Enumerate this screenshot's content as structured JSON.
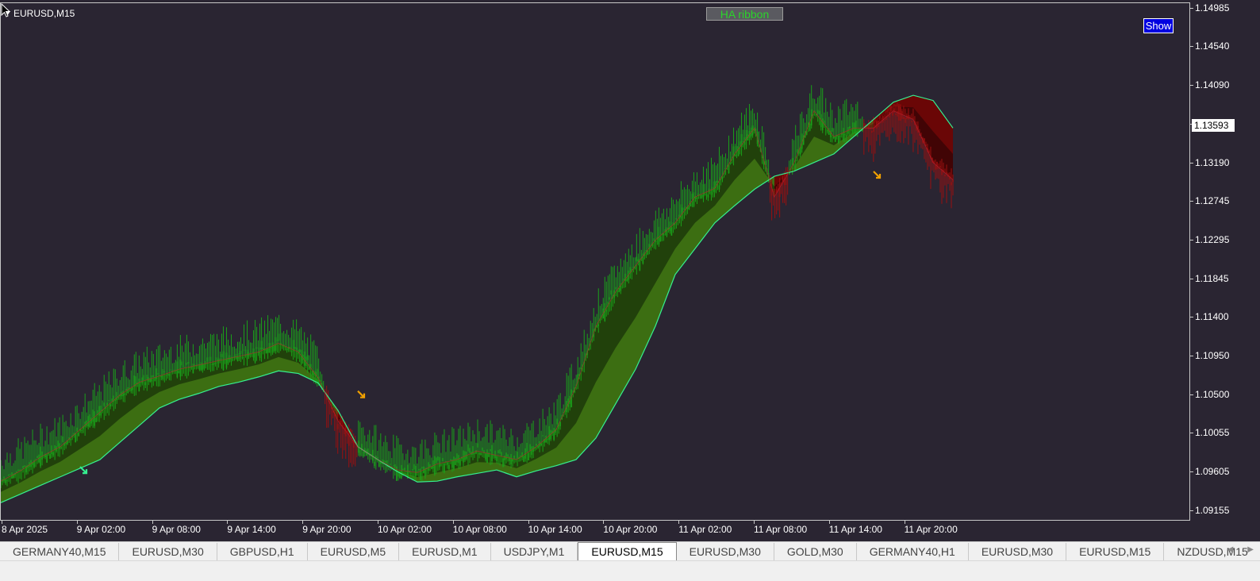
{
  "chart": {
    "symbol": "EURUSD,M15",
    "indicator_button": "HA ribbon",
    "show_button": "Show",
    "current_price": "1.13593",
    "colors": {
      "bull": "#3c6e12",
      "bull_dark": "#1c3a0b",
      "bear": "#6a0606",
      "bear_dark": "#3a0506",
      "line": "#35f090",
      "candle_up": "#1aa01a",
      "candle_dn": "#9a1010"
    }
  },
  "chart_data": {
    "type": "line",
    "title": "",
    "price_ticks": [
      "1.14985",
      "1.14540",
      "1.14090",
      "1.13640",
      "1.13190",
      "1.12745",
      "1.12295",
      "1.11845",
      "1.11400",
      "1.10950",
      "1.10500",
      "1.10055",
      "1.09605",
      "1.09155"
    ],
    "time_ticks": [
      "8 Apr 2025",
      "9 Apr 02:00",
      "9 Apr 08:00",
      "9 Apr 14:00",
      "9 Apr 20:00",
      "10 Apr 02:00",
      "10 Apr 08:00",
      "10 Apr 14:00",
      "10 Apr 20:00",
      "11 Apr 02:00",
      "11 Apr 08:00",
      "11 Apr 14:00",
      "11 Apr 20:00"
    ],
    "ylim": [
      1.0905,
      1.1505
    ],
    "series": [
      {
        "values": [
          1.0925,
          1.0935,
          1.0945,
          1.0955,
          1.0965,
          1.0975,
          1.0995,
          1.1015,
          1.1035,
          1.1045,
          1.1052,
          1.106,
          1.1065,
          1.1071,
          1.1078,
          1.1075,
          1.1064,
          1.1032,
          1.099,
          1.0975,
          1.0961,
          1.0949,
          1.095,
          1.0955,
          1.0959,
          1.0963,
          1.0955,
          1.0962,
          1.0968,
          1.0975,
          1.1,
          1.104,
          1.108,
          1.113,
          1.119,
          1.122,
          1.125,
          1.127,
          1.1289,
          1.1304,
          1.131,
          1.132,
          1.133,
          1.135,
          1.137,
          1.139,
          1.1398,
          1.1392,
          1.136
        ]
      },
      {
        "values": [
          1.095,
          1.0962,
          1.0978,
          1.099,
          1.101,
          1.103,
          1.105,
          1.1065,
          1.1072,
          1.108,
          1.1085,
          1.109,
          1.1095,
          1.11,
          1.111,
          1.11,
          1.107,
          1.102,
          1.099,
          1.0975,
          1.0963,
          1.096,
          1.097,
          1.0975,
          1.0985,
          1.098,
          1.0975,
          1.099,
          1.101,
          1.106,
          1.113,
          1.117,
          1.12,
          1.123,
          1.125,
          1.128,
          1.129,
          1.133,
          1.136,
          1.128,
          1.132,
          1.138,
          1.135,
          1.136,
          1.136,
          1.138,
          1.137,
          1.132,
          1.13
        ]
      }
    ]
  },
  "tabs": [
    "GERMANY40,M15",
    "EURUSD,M30",
    "GBPUSD,H1",
    "EURUSD,M5",
    "EURUSD,M1",
    "USDJPY,M1",
    "EURUSD,M15",
    "EURUSD,M30",
    "GOLD,M30",
    "GERMANY40,H1",
    "EURUSD,M30",
    "EURUSD,M15",
    "NZDUSD,M15"
  ],
  "active_tab": 6,
  "tab_scroll": {
    "left": "◀",
    "right": "▶"
  }
}
